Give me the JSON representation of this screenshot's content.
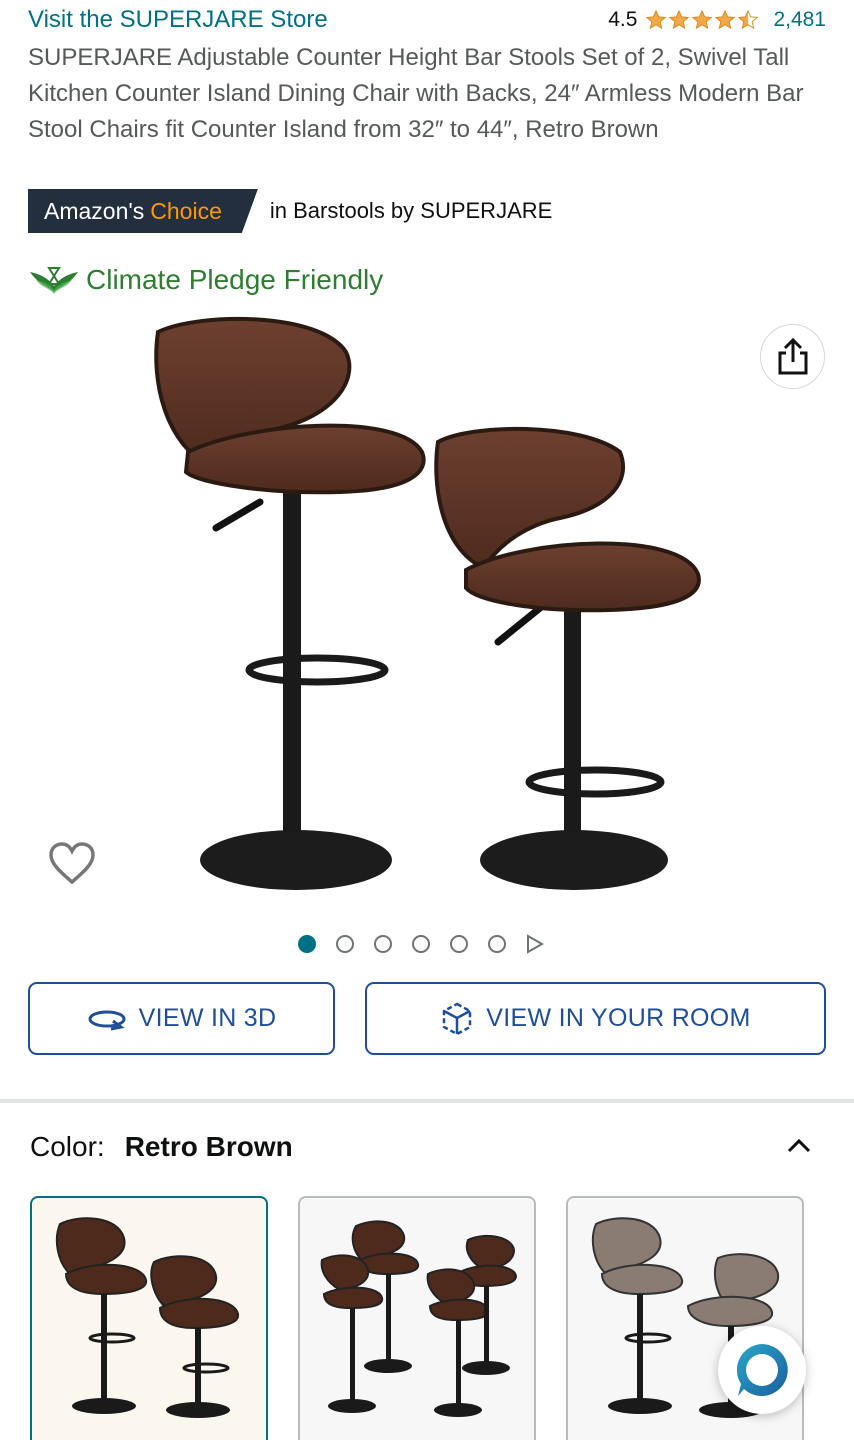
{
  "store": {
    "link_text": "Visit the SUPERJARE Store"
  },
  "rating": {
    "value": "4.5",
    "stars": 4.5,
    "count": "2,481"
  },
  "product": {
    "title": "SUPERJARE Adjustable Counter Height Bar Stools Set of 2, Swivel Tall Kitchen Counter Island Dining Chair with Backs, 24″ Armless Modern Bar Stool Chairs fit Counter Island from 32″ to 44″, Retro Brown"
  },
  "badge": {
    "prefix": "Amazon's",
    "highlight": "Choice",
    "context": "in Barstools by SUPERJARE"
  },
  "climate": {
    "label": "Climate Pledge Friendly"
  },
  "gallery": {
    "total_images": 6,
    "active_index": 0
  },
  "actions": {
    "view_3d": "VIEW IN 3D",
    "view_room": "VIEW IN YOUR ROOM"
  },
  "color": {
    "label": "Color:",
    "selected": "Retro Brown",
    "swatches": [
      {
        "name": "swatch-retro-brown-2",
        "selected": true
      },
      {
        "name": "swatch-retro-brown-4",
        "selected": false
      },
      {
        "name": "swatch-grey-2",
        "selected": false
      }
    ]
  },
  "colors": {
    "link": "#007185",
    "button_blue": "#1f4e9a",
    "badge_bg": "#232f3e",
    "choice_orange": "#ff9900",
    "star": "#f3a847",
    "climate_green": "#2e7d32"
  },
  "icons": [
    "star-icon",
    "climate-pledge-icon",
    "share-icon",
    "heart-icon",
    "rotate-3d-icon",
    "ar-cube-icon",
    "chevron-up-icon",
    "chat-icon",
    "play-icon"
  ]
}
